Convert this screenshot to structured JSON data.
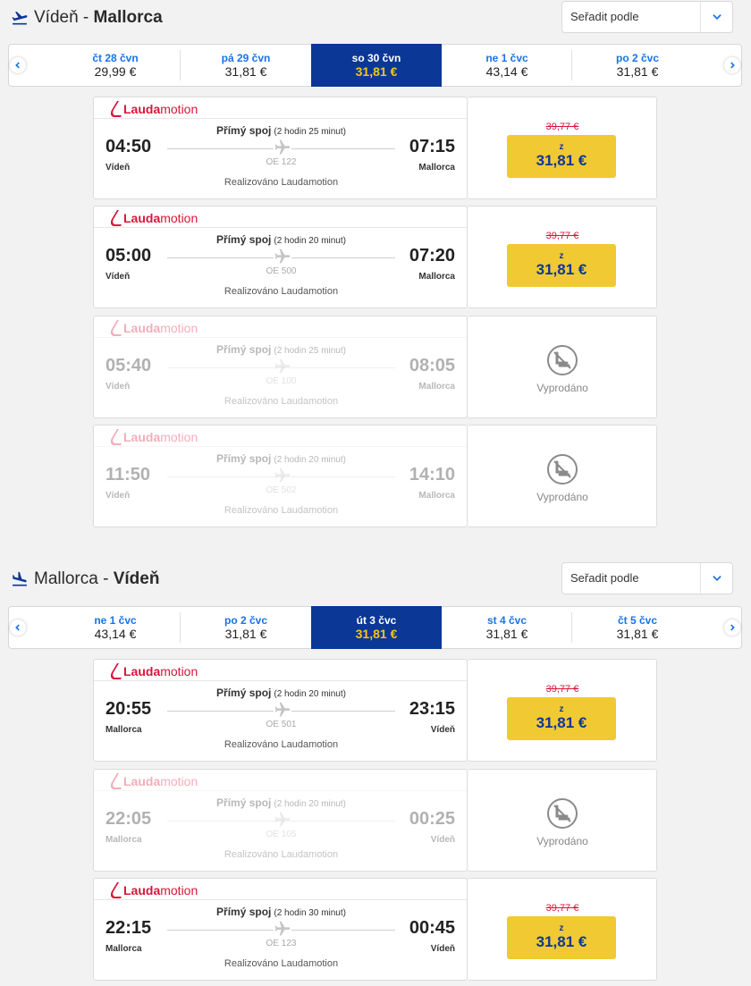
{
  "outbound": {
    "route_from": "Vídeň",
    "route_sep": " - ",
    "route_to": "Mallorca",
    "sort_label": "Seřadit podle",
    "dates": [
      {
        "label": "čt 28 čvn",
        "price": "29,99 €"
      },
      {
        "label": "pá 29 čvn",
        "price": "31,81 €"
      },
      {
        "label": "so 30 čvn",
        "price": "31,81 €",
        "selected": true
      },
      {
        "label": "ne 1 čvc",
        "price": "43,14 €"
      },
      {
        "label": "po 2 čvc",
        "price": "31,81 €"
      }
    ],
    "flights": [
      {
        "logo_bold": "Lauda",
        "logo_rest": "motion",
        "type": "Přímý spoj",
        "duration": "(2 hodin 25 minut)",
        "dep_time": "04:50",
        "arr_time": "07:15",
        "dep_city": "Vídeň",
        "arr_city": "Mallorca",
        "flight_no": "OE 122",
        "operated": "Realizováno Laudamotion",
        "old_price": "39,77 €",
        "from": "z",
        "price": "31,81 €",
        "soldout": false
      },
      {
        "logo_bold": "Lauda",
        "logo_rest": "motion",
        "type": "Přímý spoj",
        "duration": "(2 hodin 20 minut)",
        "dep_time": "05:00",
        "arr_time": "07:20",
        "dep_city": "Vídeň",
        "arr_city": "Mallorca",
        "flight_no": "OE 500",
        "operated": "Realizováno Laudamotion",
        "old_price": "39,77 €",
        "from": "z",
        "price": "31,81 €",
        "soldout": false
      },
      {
        "logo_bold": "Lauda",
        "logo_rest": "motion",
        "type": "Přímý spoj",
        "duration": "(2 hodin 25 minut)",
        "dep_time": "05:40",
        "arr_time": "08:05",
        "dep_city": "Vídeň",
        "arr_city": "Mallorca",
        "flight_no": "OE 100",
        "operated": "Realizováno Laudamotion",
        "soldout": true,
        "soldout_text": "Vyprodáno"
      },
      {
        "logo_bold": "Lauda",
        "logo_rest": "motion",
        "type": "Přímý spoj",
        "duration": "(2 hodin 20 minut)",
        "dep_time": "11:50",
        "arr_time": "14:10",
        "dep_city": "Vídeň",
        "arr_city": "Mallorca",
        "flight_no": "OE 502",
        "operated": "Realizováno Laudamotion",
        "soldout": true,
        "soldout_text": "Vyprodáno"
      }
    ]
  },
  "inbound": {
    "route_from": "Mallorca",
    "route_sep": " - ",
    "route_to": "Vídeň",
    "sort_label": "Seřadit podle",
    "dates": [
      {
        "label": "ne 1 čvc",
        "price": "43,14 €"
      },
      {
        "label": "po 2 čvc",
        "price": "31,81 €"
      },
      {
        "label": "út 3 čvc",
        "price": "31,81 €",
        "selected": true
      },
      {
        "label": "st 4 čvc",
        "price": "31,81 €"
      },
      {
        "label": "čt 5 čvc",
        "price": "31,81 €"
      }
    ],
    "flights": [
      {
        "logo_bold": "Lauda",
        "logo_rest": "motion",
        "type": "Přímý spoj",
        "duration": "(2 hodin 20 minut)",
        "dep_time": "20:55",
        "arr_time": "23:15",
        "dep_city": "Mallorca",
        "arr_city": "Vídeň",
        "flight_no": "OE 501",
        "operated": "Realizováno Laudamotion",
        "old_price": "39,77 €",
        "from": "z",
        "price": "31,81 €",
        "soldout": false
      },
      {
        "logo_bold": "Lauda",
        "logo_rest": "motion",
        "type": "Přímý spoj",
        "duration": "(2 hodin 20 minut)",
        "dep_time": "22:05",
        "arr_time": "00:25",
        "dep_city": "Mallorca",
        "arr_city": "Vídeň",
        "flight_no": "OE 105",
        "operated": "Realizováno Laudamotion",
        "soldout": true,
        "soldout_text": "Vyprodáno"
      },
      {
        "logo_bold": "Lauda",
        "logo_rest": "motion",
        "type": "Přímý spoj",
        "duration": "(2 hodin 30 minut)",
        "dep_time": "22:15",
        "arr_time": "00:45",
        "dep_city": "Mallorca",
        "arr_city": "Vídeň",
        "flight_no": "OE 123",
        "operated": "Realizováno Laudamotion",
        "old_price": "39,77 €",
        "from": "z",
        "price": "31,81 €",
        "soldout": false
      }
    ]
  },
  "colors": {
    "accent_blue": "#0b3796",
    "link_blue": "#1a73e8",
    "price_yellow": "#f1c932",
    "brand_red": "#d9163a"
  }
}
